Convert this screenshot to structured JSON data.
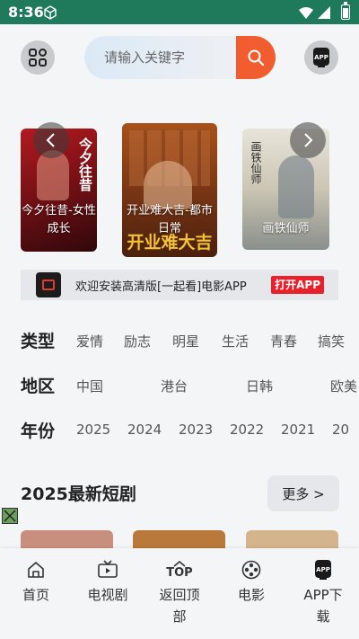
{
  "status_bar": {
    "time": "8:36"
  },
  "header": {
    "search_placeholder": "请输入关键字",
    "app_badge": "APP"
  },
  "carousel": {
    "items": [
      {
        "caption": "今夕往昔-女性成长",
        "art_text": "今夕往昔"
      },
      {
        "caption": "开业难大吉-都市日常",
        "art_text": "开业难大吉"
      },
      {
        "caption": "画铁仙师",
        "art_text": "画铁仙师"
      }
    ]
  },
  "banner": {
    "text": "欢迎安装高清版[一起看]电影APP",
    "button": "打开APP"
  },
  "filters": {
    "type": {
      "label": "类型",
      "options": [
        "爱情",
        "励志",
        "明星",
        "生活",
        "青春",
        "搞笑"
      ]
    },
    "region": {
      "label": "地区",
      "options": [
        "中国",
        "港台",
        "日韩",
        "欧美"
      ]
    },
    "year": {
      "label": "年份",
      "options": [
        "2025",
        "2024",
        "2023",
        "2022",
        "2021",
        "20"
      ]
    }
  },
  "section": {
    "title": "2025最新短剧",
    "more": "更多 >"
  },
  "tabbar": {
    "items": [
      {
        "label": "首页",
        "icon": "home-icon"
      },
      {
        "label": "电视剧",
        "icon": "tv-icon"
      },
      {
        "label": "返回顶部",
        "icon": "top-icon",
        "icon_text": "TOP"
      },
      {
        "label": "电影",
        "icon": "film-reel-icon"
      },
      {
        "label": "APP下载",
        "icon": "app-icon",
        "icon_text": "APP"
      }
    ]
  },
  "colors": {
    "status_bar": "#1f7a5c",
    "accent": "#f15d2f",
    "open_button": "#e8212c"
  }
}
